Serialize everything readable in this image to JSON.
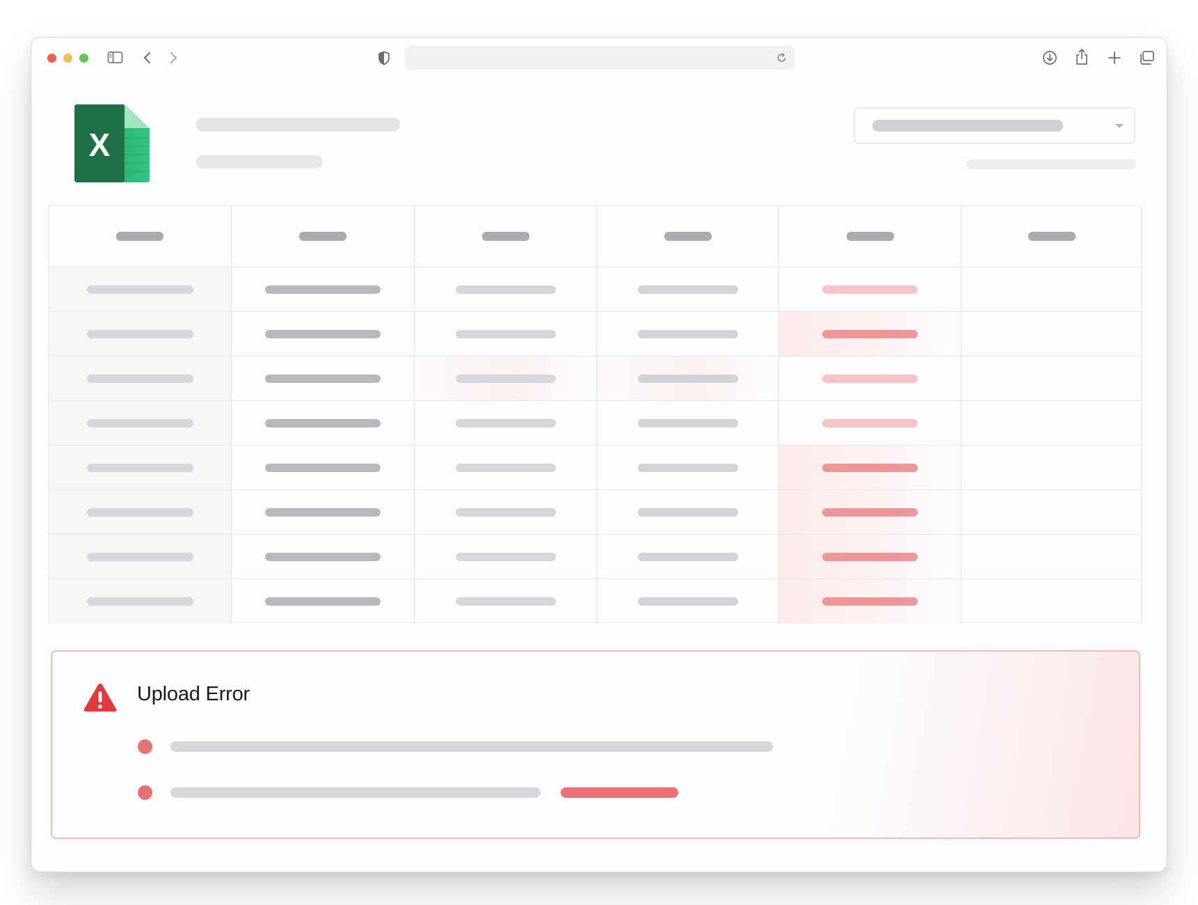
{
  "browser": {
    "url": "",
    "controls": [
      "close",
      "minimize",
      "zoom",
      "sidebar-toggle",
      "back",
      "forward",
      "privacy-shield",
      "reload",
      "downloads",
      "share",
      "new-tab",
      "tab-overview"
    ]
  },
  "file": {
    "icon": "excel-icon",
    "icon_letter": "X"
  },
  "table": {
    "columns": 6,
    "rows": 8,
    "highlight_column": 5,
    "colors": {
      "error_bar_light": "#f7c3c4",
      "error_bar_strong": "#ee9597",
      "error_highlight": "#fde9e9"
    }
  },
  "error_panel": {
    "title": "Upload Error",
    "icon": "warning-triangle-icon",
    "bullet_count": 2,
    "accent_color": "#e87173",
    "border_color": "#f2b9bb"
  },
  "excel_brand_color": "#1e7145"
}
